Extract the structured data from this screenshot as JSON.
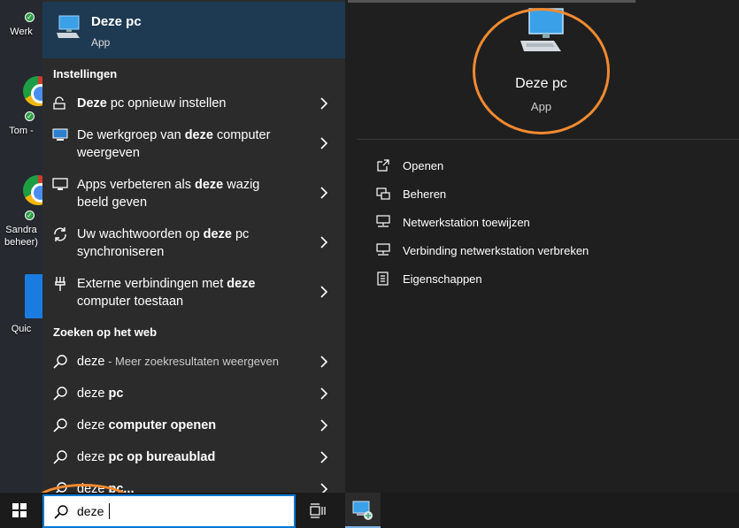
{
  "desktop": {
    "items": [
      {
        "label": "Werk"
      },
      {
        "label": "Tom -"
      },
      {
        "label_line1": "Sandra",
        "label_line2": "beheer)"
      },
      {
        "label": "Quic"
      }
    ]
  },
  "best_match": {
    "title": "Deze pc",
    "type": "App"
  },
  "sections": {
    "settings": "Instellingen",
    "web": "Zoeken op het web"
  },
  "settings_items": [
    {
      "icon": "reset-pc-icon",
      "bold1": "Deze",
      "text1": " pc opnieuw instellen"
    },
    {
      "icon": "monitor-icon",
      "text1": "De werkgroep van ",
      "bold1": "deze",
      "text2": " computer",
      "line2": "weergeven"
    },
    {
      "icon": "display-icon",
      "text1": "Apps verbeteren als ",
      "bold1": "deze",
      "text2": " wazig",
      "line2": "beeld geven"
    },
    {
      "icon": "sync-icon",
      "text1": "Uw wachtwoorden op ",
      "bold1": "deze",
      "text2": " pc",
      "line2": "synchroniseren"
    },
    {
      "icon": "remote-connections-icon",
      "text1": "Externe verbindingen met ",
      "bold1": "deze",
      "line2": "computer toestaan"
    }
  ],
  "web_items": [
    {
      "plain": "deze",
      "sub": " - Meer zoekresultaten weergeven"
    },
    {
      "plain": "deze ",
      "bold": "pc"
    },
    {
      "plain": "deze ",
      "bold": "computer openen"
    },
    {
      "plain": "deze ",
      "bold": "pc op bureaublad"
    },
    {
      "plain": "deze ",
      "bold": "pc..."
    }
  ],
  "preview": {
    "title": "Deze pc",
    "type": "App",
    "actions": [
      {
        "label": "Openen",
        "icon": "open-icon"
      },
      {
        "label": "Beheren",
        "icon": "manage-icon"
      },
      {
        "label": "Netwerkstation toewijzen",
        "icon": "map-network-drive-icon"
      },
      {
        "label": "Verbinding netwerkstation verbreken",
        "icon": "disconnect-network-drive-icon"
      },
      {
        "label": "Eigenschappen",
        "icon": "properties-icon"
      }
    ]
  },
  "taskbar": {
    "search_value": "deze"
  },
  "colors": {
    "accent": "#0078d4",
    "annotation": "#f28a30",
    "highlight": "#1e3a52"
  }
}
